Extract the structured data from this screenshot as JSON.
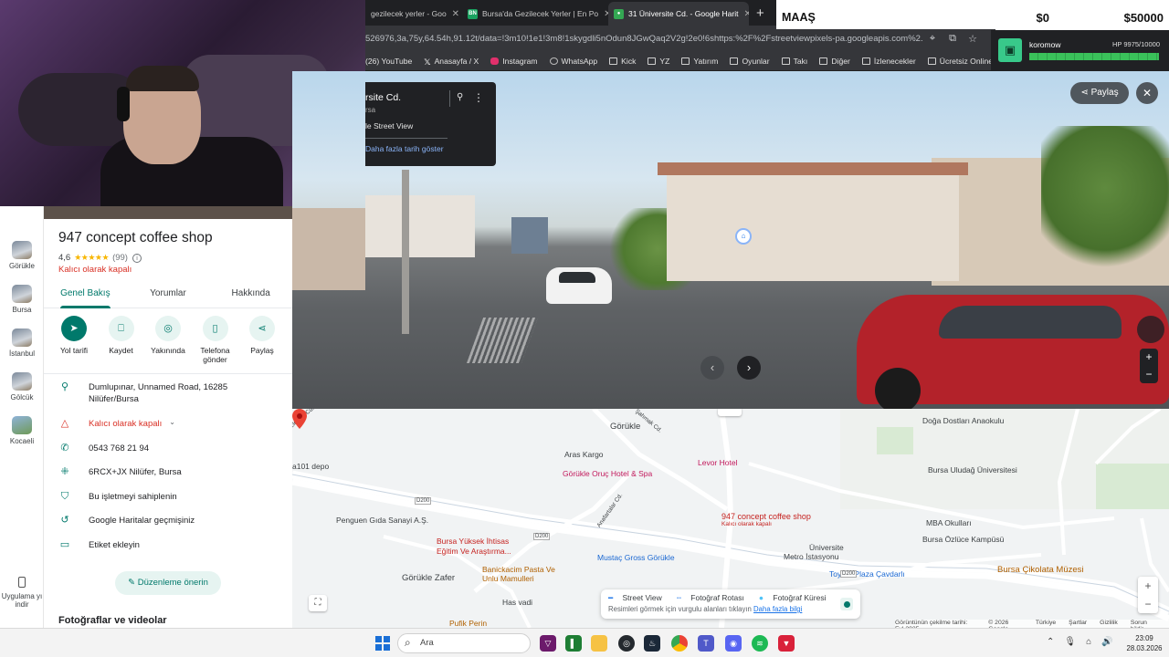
{
  "browser": {
    "tabs": [
      {
        "title": "gezilecek yerler - Goo",
        "active": false,
        "favicon_color": "#4285f4",
        "favicon": "G"
      },
      {
        "title": "Bursa'da Gezilecek Yerler | En Po",
        "active": false,
        "favicon_color": "#1aa260",
        "favicon": "BN"
      },
      {
        "title": "31 Üniversite Cd. - Google Harit",
        "active": true,
        "favicon_color": "#34a853",
        "favicon": "map-pin-icon"
      }
    ],
    "new_tab": "+",
    "url": "526976,3a,75y,64.54h,91.12t/data=!3m10!1e1!3m8!1skygdli5nOdun8JGwQaq2V2g!2e0!6shttps:%2F%2Fstreetviewpixels-pa.googleapis.com%2...",
    "bookmarks": [
      "(26) YouTube",
      "Anasayfa / X",
      "Instagram",
      "WhatsApp",
      "Kick",
      "YZ",
      "Yatırım",
      "Oyunlar",
      "Takı",
      "Diğer",
      "İzlenecekler",
      "Ücretsiz Online Resi..."
    ]
  },
  "overlay": {
    "maas_label": "MAAŞ",
    "maas_value": "$0",
    "maas_goal": "$50000",
    "hp_user": "koromow",
    "hp_text": "HP 9975/10000",
    "hp_fraction": 0.9975
  },
  "left_strip": {
    "partial_top": "...",
    "recent": [
      "Görükle",
      "Bursa",
      "İstanbul",
      "Gölcük",
      "Kocaeli"
    ],
    "bottom_label": "Uygulama yı indir"
  },
  "place": {
    "title": "947 concept coffee shop",
    "rating": "4,6",
    "stars": "★★★★★",
    "reviews": "(99)",
    "status": "Kalıcı olarak kapalı",
    "tabs": [
      "Genel Bakış",
      "Yorumlar",
      "Hakkında"
    ],
    "actions": [
      {
        "label": "Yol tarifi",
        "icon": "directions-icon"
      },
      {
        "label": "Kaydet",
        "icon": "bookmark-icon"
      },
      {
        "label": "Yakınında",
        "icon": "nearby-icon"
      },
      {
        "label": "Telefona gönder",
        "icon": "send-to-phone-icon"
      },
      {
        "label": "Paylaş",
        "icon": "share-icon"
      }
    ],
    "info": [
      {
        "icon": "location-pin-icon",
        "text": "Dumlupınar, Unnamed Road, 16285 Nilüfer/Bursa"
      },
      {
        "icon": "warning-icon",
        "text": "Kalıcı olarak kapalı"
      },
      {
        "icon": "phone-icon",
        "text": "0543 768 21 94"
      },
      {
        "icon": "plus-code-icon",
        "text": "6RCX+JX Nilüfer, Bursa"
      },
      {
        "icon": "verified-shield-icon",
        "text": "Bu işletmeyi sahiplenin"
      },
      {
        "icon": "history-icon",
        "text": "Google Haritalar geçmişiniz"
      },
      {
        "icon": "label-icon",
        "text": "Etiket ekleyin"
      }
    ],
    "edit_button": "Düzenleme önerin",
    "photos_heading": "Fotoğraflar ve videolar"
  },
  "streetview": {
    "card_title": "rsite Cd.",
    "card_sub": "rsa",
    "card_mode": "le Street View",
    "card_more": "Daha fazla tarih göster",
    "share": "Paylaş"
  },
  "map": {
    "labels": {
      "gorukle": "Görükle",
      "doga": "Doğa Dostları Anaokulu",
      "aras": "Aras Kargo",
      "levor": "Levor Hotel",
      "oruc": "Görükle Oruç Hotel & Spa",
      "uludag": "Bursa Uludağ Üniversitesi",
      "a101": "a101 depo",
      "d200a": "D200",
      "penguen": "Penguen Gıda Sanayi A.Ş.",
      "concept": "947 concept coffee shop",
      "closed": "Kalıcı olarak kapalı",
      "mba": "MBA Okulları",
      "ozluce": "Bursa Özlüce Kampüsü",
      "yuksek": "Bursa Yüksek İhtisas Eğitim Ve Araştırma...",
      "mustac": "Mustaç Gross Görükle",
      "univ": "Üniversite",
      "metro": "Metro İstasyonu",
      "toyota": "Toyota Plaza Çavdarlı",
      "cikolata": "Bursa Çikolata Müzesi",
      "zafer": "Görükle Zafer",
      "banickacim": "Banickacim Pasta Ve Unlu Mamulleri",
      "hasvadi": "Has vadi",
      "pufik": "Pufik Perin",
      "anafartalar": "Anafartalar Cd.",
      "elektrik": "Elektrik Cd.",
      "sahmak": "Şahmak Cd.",
      "d200b": "D200",
      "d200c": "D200"
    },
    "legend_items": [
      "Street View",
      "Fotoğraf Rotası",
      "Fotoğraf Küresi"
    ],
    "legend_note": "Resimleri görmek için vurgulu alanları tıklayın",
    "legend_link": "Daha fazla bilgi",
    "footer": [
      "Görüntünün çekilme tarihi: Eyl 2025",
      "© 2026 Google",
      "Türkiye",
      "Şartlar",
      "Gizlilik",
      "Sorun bildir"
    ]
  },
  "taskbar": {
    "search": "Ara",
    "time": "23:09",
    "date": "28.03.2026"
  },
  "colors": {
    "accent": "#00796b",
    "closed_red": "#d93025",
    "chrome_dark": "#35363a"
  }
}
